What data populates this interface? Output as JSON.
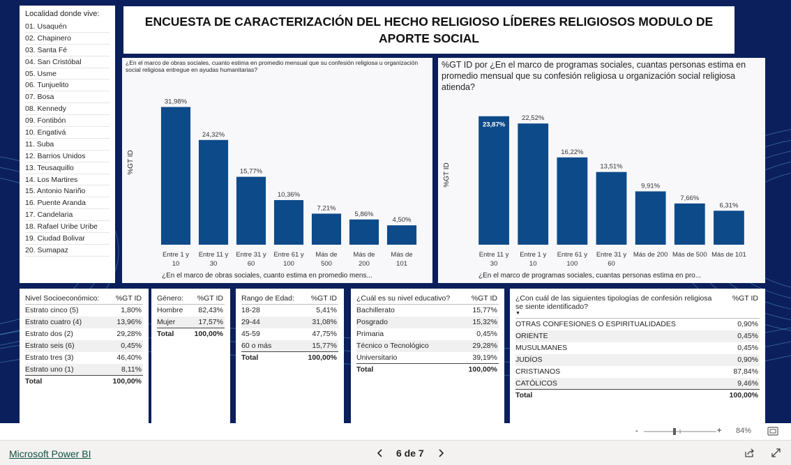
{
  "page_title": "ENCUESTA DE CARACTERIZACIÓN DEL HECHO RELIGIOSO LÍDERES RELIGIOSOS MODULO DE APORTE SOCIAL",
  "slicer": {
    "title": "Localidad donde vive:",
    "items": [
      "01. Usaquén",
      "02. Chapinero",
      "03. Santa Fé",
      "04. San Cristóbal",
      "05. Usme",
      "06. Tunjuelito",
      "07. Bosa",
      "08. Kennedy",
      "09. Fontibón",
      "10. Engativá",
      "11. Suba",
      "12. Barrios Unidos",
      "13. Teusaquillo",
      "14. Los Martires",
      "15. Antonio Nariño",
      "16. Puente Aranda",
      "17. Candelaria",
      "18. Rafael Uribe Uribe",
      "19. Ciudad Bolivar",
      "20. Sumapaz"
    ]
  },
  "chart_data": [
    {
      "type": "bar",
      "title": "¿En el marco de obras sociales, cuanto estima en promedio mensual que su confesión religiosa u organización social religiosa entregue en ayudas humanitarias?",
      "ylabel": "%GT ID",
      "xlabel": "¿En el marco de obras sociales, cuanto estima en promedio mens...",
      "categories": [
        [
          "Entre 1 y",
          "10"
        ],
        [
          "Entre 11 y",
          "30"
        ],
        [
          "Entre 31 y",
          "60"
        ],
        [
          "Entre 61 y",
          "100"
        ],
        [
          "Más de",
          "500"
        ],
        [
          "Más de",
          "200"
        ],
        [
          "Más de",
          "101"
        ]
      ],
      "values": [
        31.98,
        24.32,
        15.77,
        10.36,
        7.21,
        5.86,
        4.5
      ],
      "labels": [
        "31,98%",
        "24,32%",
        "15,77%",
        "10,36%",
        "7,21%",
        "5,86%",
        "4,50%"
      ],
      "ylim": [
        0,
        34
      ],
      "color": "#0d4a8a"
    },
    {
      "type": "bar",
      "title": "%GT ID por ¿En el marco de programas sociales, cuantas personas estima en promedio mensual que su confesión religiosa u organización social religiosa atienda?",
      "ylabel": "%GT ID",
      "xlabel": "¿En el marco de programas sociales, cuantas personas estima en pro...",
      "categories": [
        [
          "Entre 11 y",
          "30"
        ],
        [
          "Entre 1 y",
          "10"
        ],
        [
          "Entre 61 y",
          "100"
        ],
        [
          "Entre 31 y",
          "60"
        ],
        [
          "Más de 200"
        ],
        [
          "Más de 500"
        ],
        [
          "Más de 101"
        ]
      ],
      "values": [
        23.87,
        22.52,
        16.22,
        13.51,
        9.91,
        7.66,
        6.31
      ],
      "labels": [
        "23,87%",
        "22,52%",
        "16,22%",
        "13,51%",
        "9,91%",
        "7,66%",
        "6,31%"
      ],
      "ylim": [
        0,
        25
      ],
      "color": "#0d4a8a"
    }
  ],
  "tables": {
    "nivel": {
      "headers": [
        "Nivel Socioeconómico:",
        "%GT ID"
      ],
      "rows": [
        [
          "Estrato cinco (5)",
          "1,80%"
        ],
        [
          "Estrato cuatro (4)",
          "13,96%"
        ],
        [
          "Estrato dos (2)",
          "29,28%"
        ],
        [
          "Estrato seis (6)",
          "0,45%"
        ],
        [
          "Estrato tres (3)",
          "46,40%"
        ],
        [
          "Estrato uno (1)",
          "8,11%"
        ]
      ],
      "total": [
        "Total",
        "100,00%"
      ]
    },
    "genero": {
      "headers": [
        "Género:",
        "%GT ID"
      ],
      "rows": [
        [
          "Hombre",
          "82,43%"
        ],
        [
          "Mujer",
          "17,57%"
        ]
      ],
      "total": [
        "Total",
        "100,00%"
      ]
    },
    "edad": {
      "headers": [
        "Rango de Edad:",
        "%GT ID"
      ],
      "rows": [
        [
          "18-28",
          "5,41%"
        ],
        [
          "29-44",
          "31,08%"
        ],
        [
          "45-59",
          "47,75%"
        ],
        [
          "60 o más",
          "15,77%"
        ]
      ],
      "total": [
        "Total",
        "100,00%"
      ]
    },
    "educativo": {
      "headers": [
        "¿Cuál es su nivel educativo?",
        "%GT ID"
      ],
      "rows": [
        [
          "Bachillerato",
          "15,77%"
        ],
        [
          "Posgrado",
          "15,32%"
        ],
        [
          "Primaria",
          "0,45%"
        ],
        [
          "Técnico o Tecnológico",
          "29,28%"
        ],
        [
          "Universitario",
          "39,19%"
        ]
      ],
      "total": [
        "Total",
        "100,00%"
      ]
    },
    "tipologia": {
      "headers": [
        "¿Con cuál de las siguientes tipologías de confesión religiosa se siente identificado?",
        "%GT ID"
      ],
      "rows": [
        [
          "OTRAS CONFESIONES O ESPIRITUALIDADES",
          "0,90%"
        ],
        [
          "ORIENTE",
          "0,45%"
        ],
        [
          "MUSULMANES",
          "0,45%"
        ],
        [
          "JUDÍOS",
          "0,90%"
        ],
        [
          "CRISTIANOS",
          "87,84%"
        ],
        [
          "CATÓLICOS",
          "9,46%"
        ]
      ],
      "total": [
        "Total",
        "100,00%"
      ]
    }
  },
  "zoom": {
    "minus": "-",
    "plus": "+",
    "level": "84%"
  },
  "footer": {
    "brand": "Microsoft Power BI",
    "page": "6 de 7"
  },
  "colors": {
    "background": "#0b1f5c",
    "bar": "#0d4a8a",
    "brand": "#0f4f41"
  },
  "icons": [
    "fit-page-icon",
    "prev-page-icon",
    "next-page-icon",
    "share-icon",
    "fullscreen-icon"
  ]
}
